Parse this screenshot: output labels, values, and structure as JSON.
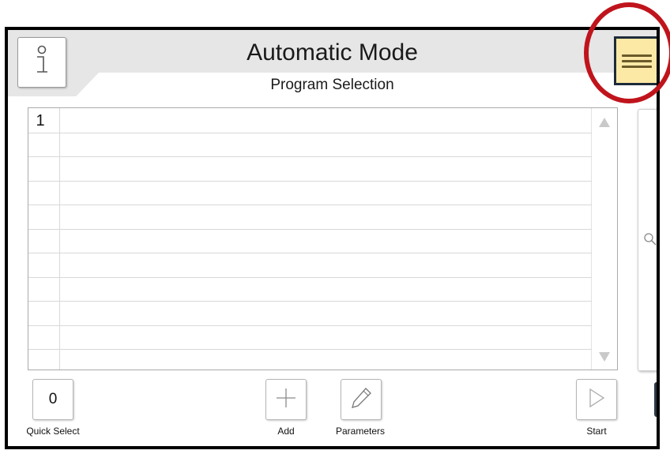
{
  "header": {
    "title": "Automatic Mode",
    "subtitle": "Program Selection"
  },
  "program_list": {
    "rows": [
      "1",
      "",
      "",
      "",
      "",
      "",
      "",
      "",
      "",
      "",
      ""
    ]
  },
  "toolbar": {
    "quick_select_value": "0",
    "quick_select_label": "Quick Select",
    "add_label": "Add",
    "parameters_label": "Parameters",
    "start_label": "Start"
  },
  "icons": {
    "info": "info-icon",
    "menu": "hamburger-menu-icon",
    "search": "search-icon",
    "add": "plus-icon",
    "parameters": "pencil-icon",
    "start": "play-icon",
    "scroll_up": "triangle-up-icon",
    "scroll_down": "triangle-down-icon"
  },
  "colors": {
    "menu_button_bg": "#fde9a6",
    "menu_button_border": "#1e2b3a",
    "highlight_ring": "#c0141c",
    "header_band": "#e6e6e6"
  }
}
